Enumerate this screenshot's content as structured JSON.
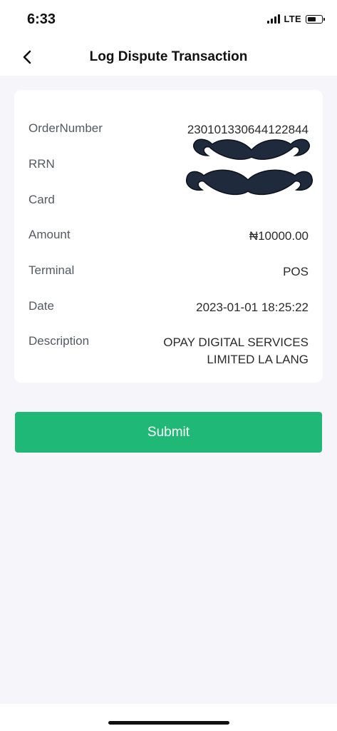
{
  "status_bar": {
    "time": "6:33",
    "network": "LTE",
    "icons": [
      "signal-icon",
      "battery-icon"
    ]
  },
  "header": {
    "title": "Log Dispute Transaction",
    "back_icon": "chevron-left-icon"
  },
  "details": {
    "order_number": {
      "label": "OrderNumber",
      "value": "230101330644122844"
    },
    "rrn": {
      "label": "RRN",
      "value": ""
    },
    "card": {
      "label": "Card",
      "value": ""
    },
    "amount": {
      "label": "Amount",
      "value": "₦10000.00"
    },
    "terminal": {
      "label": "Terminal",
      "value": "POS"
    },
    "date": {
      "label": "Date",
      "value": "2023-01-01 18:25:22"
    },
    "description": {
      "label": "Description",
      "value_line1": "OPAY DIGITAL SERVICES",
      "value_line2": "LIMITED LA LANG"
    }
  },
  "redaction_icon": "mustache-icon",
  "submit_label": "Submit",
  "colors": {
    "accent": "#1fb876",
    "background": "#f6f6fa",
    "card": "#ffffff",
    "mustache": "#1f2a3c"
  }
}
